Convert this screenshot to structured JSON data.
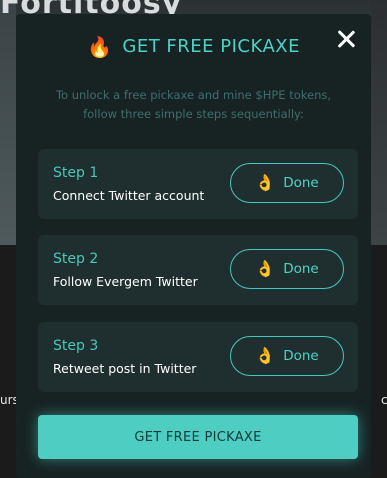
{
  "background": {
    "title_fragment": "Fortitoosy",
    "left_edge_text": "urs",
    "right_edge_text": "c"
  },
  "modal": {
    "title_icon": "fire-emoji",
    "title": "GET FREE PICKAXE",
    "subtitle": "To unlock a free pickaxe and mine $HPE tokens, follow three simple steps sequentially:",
    "steps": [
      {
        "number": "Step 1",
        "description": "Connect Twitter account",
        "button_icon": "ok-hand-emoji",
        "button_label": "Done"
      },
      {
        "number": "Step 2",
        "description": "Follow Evergem Twitter",
        "button_icon": "ok-hand-emoji",
        "button_label": "Done"
      },
      {
        "number": "Step 3",
        "description": "Retweet post in Twitter",
        "button_icon": "ok-hand-emoji",
        "button_label": "Done"
      }
    ],
    "cta_label": "GET FREE PICKAXE"
  },
  "colors": {
    "accent": "#4cd3c7",
    "modal_bg": "#172223",
    "step_bg": "#1f2f2f",
    "cta_bg": "#4ecdc3"
  }
}
